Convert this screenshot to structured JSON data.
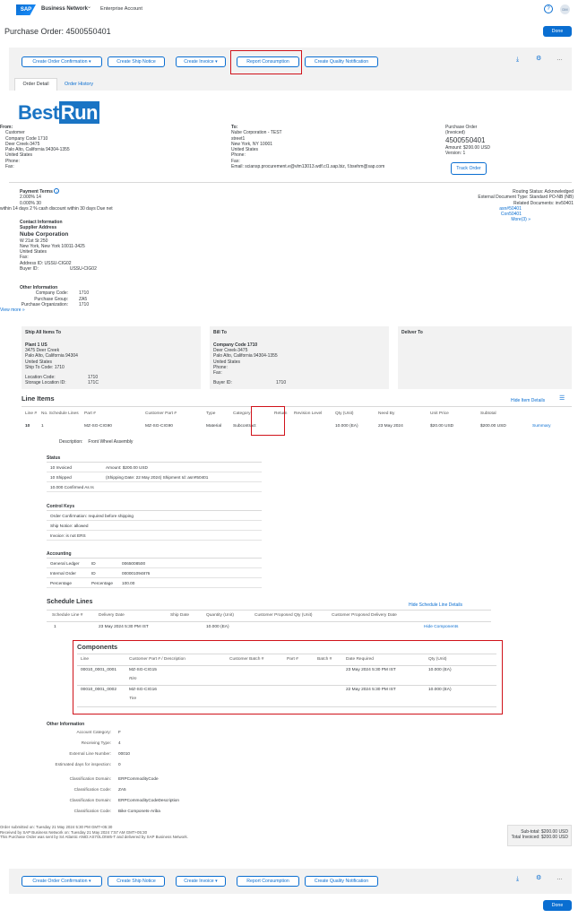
{
  "header": {
    "logo": "SAP",
    "network": "Business Network",
    "network_chevron": "⌄",
    "account": "Enterprise Account",
    "help_icon": "?",
    "avatar": "DM"
  },
  "page": {
    "title": "Purchase Order: 4500550401",
    "done": "Done"
  },
  "actions": {
    "confirm": "Create Order Confirmation",
    "ship": "Create Ship Notice",
    "invoice": "Create Invoice",
    "consumption": "Report Consumption",
    "quality": "Create Quality Notification",
    "caret": "▾",
    "download_icon": "⤓",
    "settings_icon": "⚙",
    "more_icon": "…"
  },
  "tabs": {
    "detail": "Order Detail",
    "history": "Order History"
  },
  "brand": {
    "text_a": "Best",
    "text_b": "Run"
  },
  "from": {
    "label": "From:",
    "lines": [
      "Customer",
      "Company Code 1710",
      "Deer Creek-3475",
      "Palo Alto, California 94304-1355",
      "United States",
      "Phone:",
      "Fax:"
    ]
  },
  "to": {
    "label": "To:",
    "lines": [
      "Nube  Corporation  - TEST",
      "street1",
      "New York, NY 10001",
      "United States",
      "Phone:",
      "Fax:",
      "Email: sciansp.procurement.e@vlm13013.wdf.cl1.sap.biz, f.bsehm@sap.com"
    ]
  },
  "po": {
    "label": "Purchase Order",
    "status": "(Invoiced)",
    "number": "4500550401",
    "amount": "Amount: $200.00 USD",
    "version": "Version: 1",
    "track": "Track Order"
  },
  "terms": {
    "label": "Payment Terms",
    "info_icon": "i",
    "l1": "2.000% 14",
    "l2": "0.000% 30",
    "l3": "within 14 days 2 % cash discount within 30 days Due net"
  },
  "routing": {
    "l1": "Routing Status: Acknowledged",
    "l2": "External Document Type: Standard PO-NB (NB)",
    "l3": "Related Documents: inv50401",
    "l4": "asn#50401",
    "l5": "Con50401",
    "l6": "More(3) »"
  },
  "contact": {
    "title": "Contact Information",
    "sub": "Supplier Address",
    "name": "Nube  Corporation",
    "lines": [
      "W 21st St 250",
      "New York, New York 10011-3425",
      "United States",
      "Fax:",
      "Address ID:  USSU-CIG02"
    ],
    "buyer_label": "Buyer ID:",
    "buyer_val": "USSU-CIG02"
  },
  "other1": {
    "title": "Other Information",
    "cc_l": "Company Code:",
    "cc_v": "1710",
    "pg_l": "Purchase Group:",
    "pg_v": "ZA5",
    "po_l": "Purchase Organization:",
    "po_v": "1710",
    "more": "View more »"
  },
  "ship": {
    "title": "Ship All Items To",
    "name": "Plant 1 US",
    "lines": [
      "3475 Deer Creek",
      "Palo Alto, California 94304",
      "United States",
      "Ship To Code:  1710"
    ],
    "loc_l": "Location Code:",
    "loc_v": "1710",
    "stor_l": "Storage Location ID:",
    "stor_v": "171C"
  },
  "bill": {
    "title": "Bill To",
    "name": "Company Code 1710",
    "lines": [
      "Deer Creek-3475",
      "Palo Alto, California 94304-1355",
      "United States",
      "Phone:",
      "Fax:"
    ],
    "buyer_l": "Buyer ID:",
    "buyer_v": "1710"
  },
  "deliver": {
    "title": "Deliver To"
  },
  "li": {
    "title": "Line Items",
    "hide": "Hide Item Details",
    "menu_icon": "☰",
    "h": [
      "Line #",
      "No. Schedule Lines",
      "Part #",
      "Customer Part #",
      "Type",
      "Category",
      "Return",
      "Revision Level",
      "Qty (Unit)",
      "Need By",
      "Unit Price",
      "Subtotal"
    ],
    "r": [
      "10",
      "1",
      "MZ-SG-CIG90",
      "MZ-SG-CIG90",
      "Material",
      "Subcontract",
      "",
      "",
      "10.000 (EA)",
      "23 May 2024",
      "$20.00 USD",
      "$200.00 USD",
      "Summary"
    ],
    "desc_l": "Description:",
    "desc_v": "Front Wheel Assembly"
  },
  "status": {
    "title": "Status",
    "rows": [
      "10 Invoiced",
      "10 Shipped",
      "10.000 Confirmed As Is"
    ],
    "d1": "Amount:  $200.00 USD",
    "d2": "(Shipping Date: 22 May 2024) Shipment Id: asn#50401"
  },
  "ctrl": {
    "title": "Control Keys",
    "rows": [
      "Order Confirmation:  required before shipping",
      "Ship Notice:  allowed",
      "Invoice:  is not ERS"
    ]
  },
  "acct": {
    "title": "Accounting",
    "r": [
      [
        "General Ledger",
        "ID",
        "0065008500"
      ],
      [
        "Internal Order",
        "ID",
        "000001094876"
      ],
      [
        "Percentage",
        "Percentage",
        "100.00"
      ]
    ]
  },
  "sched": {
    "title": "Schedule Lines",
    "hide": "Hide Schedule Line Details",
    "h": [
      "Schedule Line #",
      "Delivery Date",
      "Ship Date",
      "Quantity (Unit)",
      "Customer Proposed Qty (Unit)",
      "Customer Proposed Delivery Date"
    ],
    "r": [
      "1",
      "23 May 2024 5:30 PM IST",
      "",
      "10.000 (EA)",
      "",
      ""
    ],
    "hidecomp": "Hide Components"
  },
  "comp": {
    "title": "Components",
    "h": [
      "Line",
      "Customer Part # / Description",
      "Customer Batch #",
      "Part #",
      "Batch #",
      "Date Required",
      "Qty (Unit)"
    ],
    "r1": [
      "00010_0001_0001",
      "MZ-SG-CIG15",
      "Rim",
      "23 May 2024 5:30 PM IST",
      "10.000 (EA)"
    ],
    "r2": [
      "00010_0001_0002",
      "MZ-SG-CIG16",
      "Tire",
      "22 May 2024 5:30 PM IST",
      "10.000 (EA)"
    ]
  },
  "other2": {
    "title": "Other Information",
    "r": [
      [
        "Account Category:",
        "F"
      ],
      [
        "Receiving Type:",
        "4"
      ],
      [
        "External Line Number:",
        "00010"
      ],
      [
        "Estimated days for inspection:",
        "0"
      ],
      [
        "Classification Domain:",
        "ERPCommodityCode"
      ],
      [
        "Classification Code:",
        "ZA5"
      ],
      [
        "Classification Domain:",
        "ERPCommodityCodeDescription"
      ],
      [
        "Classification Code:",
        "Bike Componets-Ariba"
      ]
    ]
  },
  "footer": {
    "l1": "Order submitted on: Tuesday 21 May 2024 5:30 PM GMT+05:30",
    "l2": "Received by SAP Business Network on: Tuesday 21 May 2024 7:57 AM GMT+05:30",
    "l3": "This Purchase Order was sent by S4 Atlantic ANID:AS7OLOIW6-T and delivered by SAP Business Network.",
    "subtotal": "Sub-total: $200.00 USD",
    "total": "Total Invoiced: $200.00 USD"
  }
}
